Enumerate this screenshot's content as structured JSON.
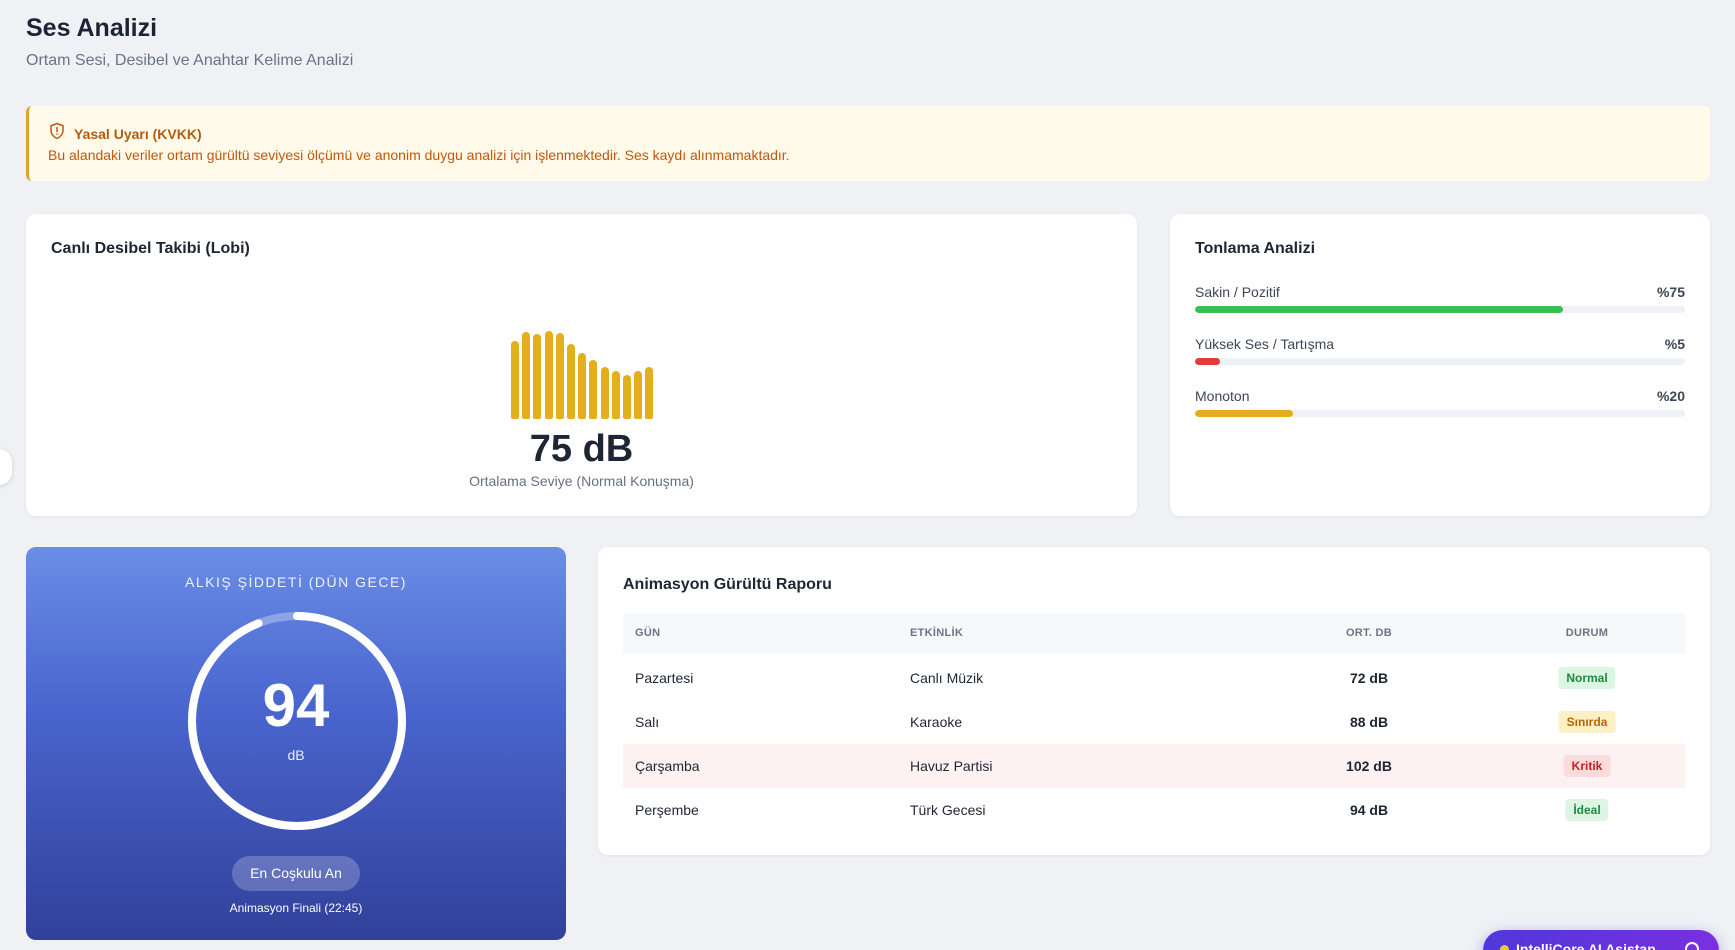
{
  "header": {
    "title": "Ses Analizi",
    "subtitle": "Ortam Sesi, Desibel ve Anahtar Kelime Analizi"
  },
  "alert": {
    "icon": "shield-alert-icon",
    "title": "Yasal Uyarı (KVKK)",
    "text": "Bu alandaki veriler ortam gürültü seviyesi ölçümü ve anonim duygu analizi için işlenmektedir. Ses kaydı alınmamaktadır.",
    "color": "#c2570c"
  },
  "decibel": {
    "title": "Canlı Desibel Takibi (Lobi)",
    "value": "75 dB",
    "caption": "Ortalama Seviye (Normal Konuşma)",
    "bar_color": "#e3b01b",
    "bars": [
      0.85,
      0.95,
      0.92,
      0.96,
      0.93,
      0.82,
      0.72,
      0.64,
      0.57,
      0.52,
      0.48,
      0.52,
      0.57
    ]
  },
  "tone": {
    "title": "Tonlama Analizi",
    "items": [
      {
        "label": "Sakin / Pozitif",
        "value": "%75",
        "fraction": 0.75,
        "color": "#3cbf52"
      },
      {
        "label": "Yüksek Ses / Tartışma",
        "value": "%5",
        "fraction": 0.05,
        "color": "#e23c3c"
      },
      {
        "label": "Monoton",
        "value": "%20",
        "fraction": 0.2,
        "color": "#e3b01b"
      }
    ]
  },
  "applause": {
    "title": "ALKIŞ ŞİDDETİ (DÜN GECE)",
    "value": "94",
    "unit": "dB",
    "fraction": 0.94,
    "peak_label": "En Coşkulu An",
    "peak_detail": "Animasyon Finali (22:45)"
  },
  "report": {
    "title": "Animasyon Gürültü Raporu",
    "columns": [
      "GÜN",
      "ETKİNLİK",
      "ORT. DB",
      "DURUM"
    ],
    "rows": [
      {
        "day": "Pazartesi",
        "event": "Canlı Müzik",
        "avg": "72 dB",
        "status": "Normal",
        "status_color": "#1d8a3e",
        "status_bg": "#ddf5e3"
      },
      {
        "day": "Salı",
        "event": "Karaoke",
        "avg": "88 dB",
        "status": "Sınırda",
        "status_color": "#b8650a",
        "status_bg": "#fdf0c4"
      },
      {
        "day": "Çarşamba",
        "event": "Havuz Partisi",
        "avg": "102 dB",
        "status": "Kritik",
        "status_color": "#c41f1f",
        "status_bg": "#fbdcdc"
      },
      {
        "day": "Perşembe",
        "event": "Türk Gecesi",
        "avg": "94 dB",
        "status": "İdeal",
        "status_color": "#1d8a3e",
        "status_bg": "#ddf5e3"
      }
    ]
  },
  "assistant": {
    "label": "IntelliCore AI Asistan"
  }
}
